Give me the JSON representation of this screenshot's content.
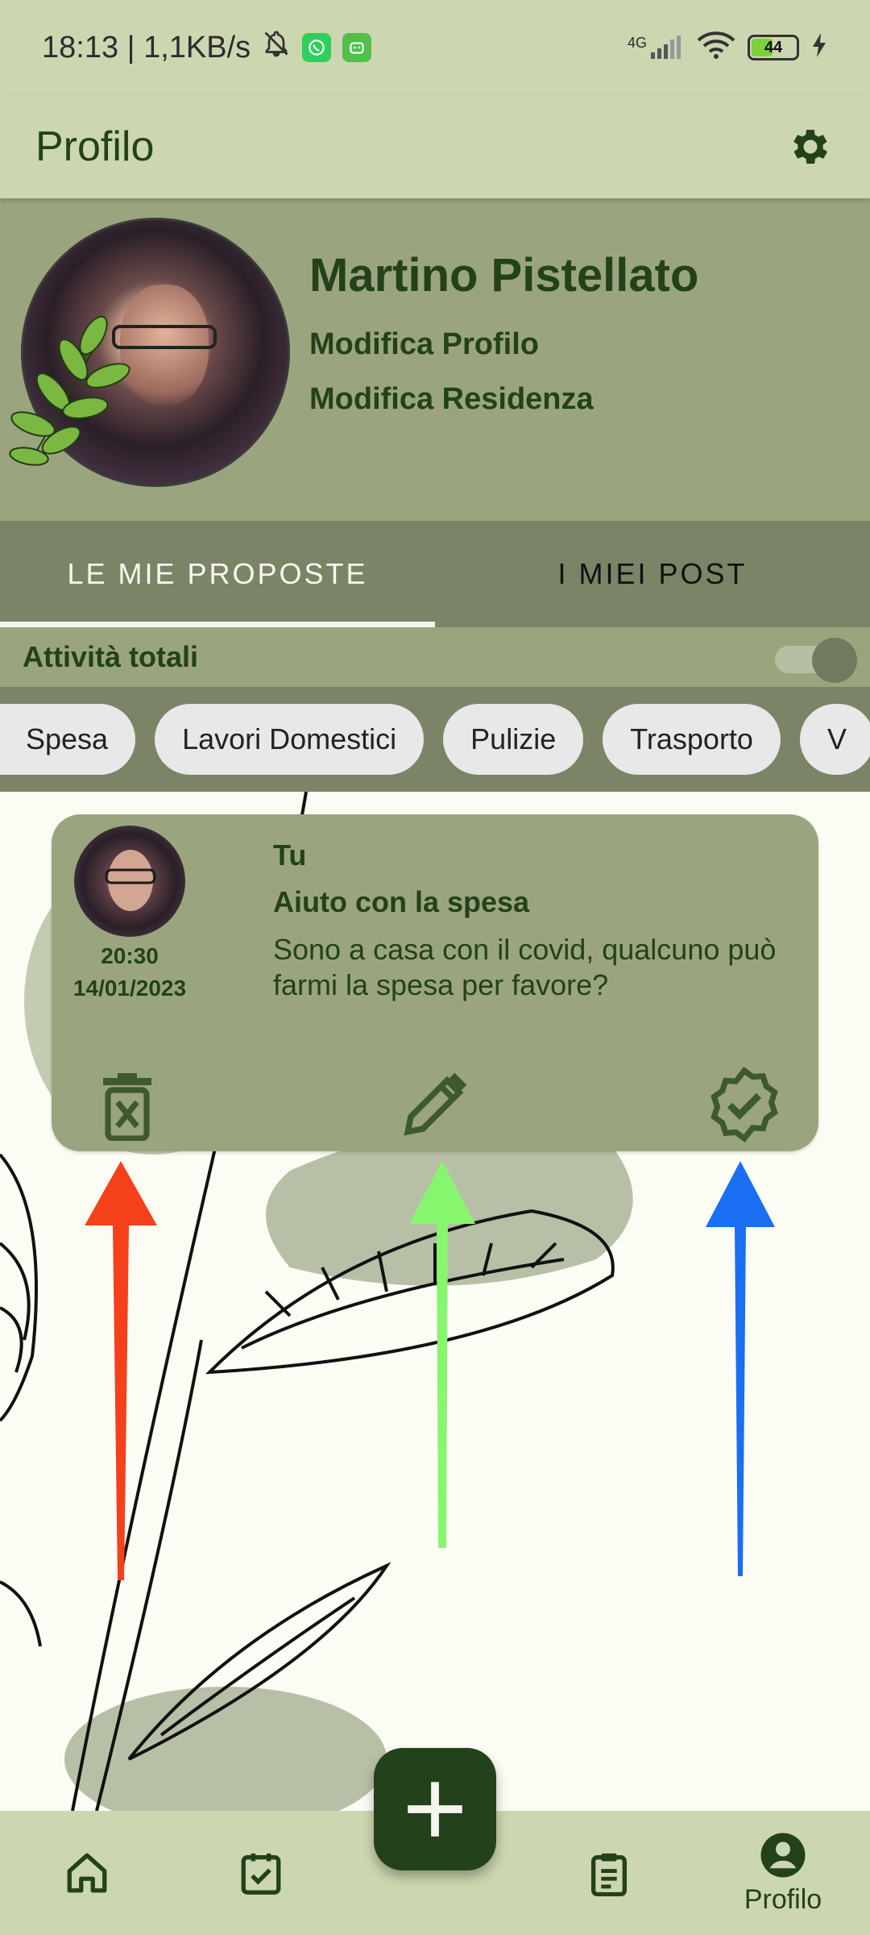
{
  "status_bar": {
    "time_speed": "18:13 | 1,1KB/s",
    "network": "4G",
    "battery": "44",
    "icons": [
      "bell-off-icon",
      "whatsapp-icon",
      "android-icon",
      "signal-icon",
      "wifi-icon",
      "battery-icon",
      "charging-icon"
    ]
  },
  "app_bar": {
    "title": "Profilo",
    "settings_icon": "gear-icon"
  },
  "profile": {
    "name": "Martino Pistellato",
    "edit_profile": "Modifica Profilo",
    "edit_residence": "Modifica Residenza"
  },
  "tabs": [
    {
      "label": "LE MIE PROPOSTE",
      "active": true
    },
    {
      "label": "I MIEI POST",
      "active": false
    }
  ],
  "filter": {
    "label": "Attività totali",
    "toggle_on": true
  },
  "chips": [
    "Spesa",
    "Lavori Domestici",
    "Pulizie",
    "Trasporto",
    "V"
  ],
  "card": {
    "user": "Tu",
    "time": "20:30",
    "date": "14/01/2023",
    "title": "Aiuto con la spesa",
    "description": "Sono a casa con il covid, qualcuno può farmi la spesa per favore?",
    "actions": [
      "delete-icon",
      "edit-icon",
      "verified-icon"
    ]
  },
  "annotation_arrows": {
    "colors": [
      "#f4411b",
      "#88f56f",
      "#1a6ff2"
    ]
  },
  "colors": {
    "dark_green": "#23411a",
    "header_bg": "#ccd6b0",
    "olive": "#9aa57f",
    "tab_bg": "#7b8466"
  },
  "bottom_nav": {
    "items": [
      {
        "icon": "home-icon",
        "label": ""
      },
      {
        "icon": "task-check-icon",
        "label": ""
      },
      {
        "icon": "clipboard-list-icon",
        "label": ""
      },
      {
        "icon": "account-icon",
        "label": "Profilo"
      }
    ],
    "fab_icon": "plus-icon"
  }
}
